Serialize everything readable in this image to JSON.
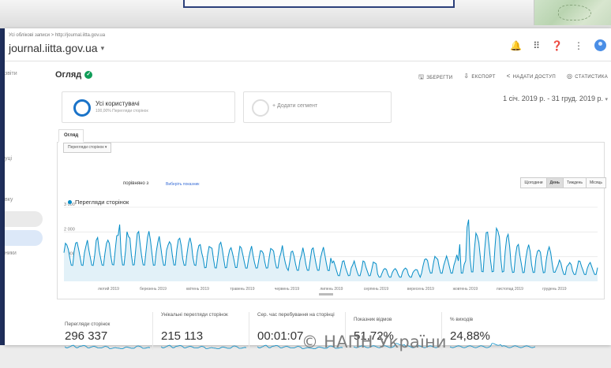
{
  "header": {
    "breadcrumb": "Усі облікові записи > http://journal.iitta.gov.ua",
    "site_title": "journal.iitta.gov.ua"
  },
  "sidenav": {
    "items": [
      "звіти",
      "уці",
      "вку",
      "ники"
    ]
  },
  "overview": {
    "title": "Огляд"
  },
  "actions": [
    {
      "icon": "save-icon",
      "label": "ЗБЕРЕГТИ"
    },
    {
      "icon": "export-icon",
      "label": "ЕКСПОРТ"
    },
    {
      "icon": "share-icon",
      "label": "НАДАТИ ДОСТУП"
    },
    {
      "icon": "insights-icon",
      "label": "СТАТИСТИКА"
    }
  ],
  "segments": {
    "active_title": "Усі користувачі",
    "active_sub": "100,00% Перегляди сторінок",
    "add_label": "+ Додати сегмент"
  },
  "date_range": "1 січ. 2019 р. - 31 груд. 2019 р.",
  "tabs": [
    "Огляд"
  ],
  "chart_controls": {
    "metric": "Перегляди сторінок",
    "compare": "порівняно з",
    "choose": "Виберіть показник",
    "granularity": [
      "Щогодини",
      "День",
      "Тиждень",
      "Місяць"
    ],
    "active_granularity": "День"
  },
  "chart_data": {
    "type": "area",
    "title": "",
    "series": [
      {
        "name": "Перегляди сторінок",
        "color": "#058dc7"
      }
    ],
    "ylabel": "",
    "y_ticks": [
      "3 000",
      "2 000",
      "1 000"
    ],
    "ylim": [
      0,
      3000
    ],
    "x_ticks": [
      "лютий 2019",
      "березень 2019",
      "квітень 2019",
      "травень 2019",
      "червень 2019",
      "липень 2019",
      "серпень 2019",
      "вересень 2019",
      "жовтень 2019",
      "листопад 2019",
      "грудень 2019"
    ],
    "monthly_profile": [
      {
        "month": "січень 2019",
        "low": 600,
        "high": 1800
      },
      {
        "month": "лютий 2019",
        "low": 600,
        "high": 2200
      },
      {
        "month": "березень 2019",
        "low": 600,
        "high": 1900
      },
      {
        "month": "квітень 2019",
        "low": 500,
        "high": 1700
      },
      {
        "month": "травень 2019",
        "low": 500,
        "high": 1500
      },
      {
        "month": "червень 2019",
        "low": 400,
        "high": 1400
      },
      {
        "month": "липень 2019",
        "low": 200,
        "high": 900
      },
      {
        "month": "серпень 2019",
        "low": 150,
        "high": 600
      },
      {
        "month": "вересень 2019",
        "low": 300,
        "high": 1100
      },
      {
        "month": "жовтень 2019",
        "low": 300,
        "high": 2400
      },
      {
        "month": "листопад 2019",
        "low": 300,
        "high": 1700
      },
      {
        "month": "грудень 2019",
        "low": 250,
        "high": 900
      }
    ],
    "grid": true,
    "legend": "top-left"
  },
  "metrics": [
    {
      "label": "Перегляди сторінок",
      "value": "296 337"
    },
    {
      "label": "Унікальні перегляди сторінок",
      "value": "215 113"
    },
    {
      "label": "Сер. час перебування на сторінці",
      "value": "00:01:07"
    },
    {
      "label": "Показник відмов",
      "value": "51,72%"
    },
    {
      "label": "% виходів",
      "value": "24,88%"
    }
  ],
  "footer": {
    "copyright": "© НАПН України"
  },
  "colors": {
    "accent": "#058dc7",
    "frame": "#1f2f5c",
    "check": "#0f9d58"
  }
}
